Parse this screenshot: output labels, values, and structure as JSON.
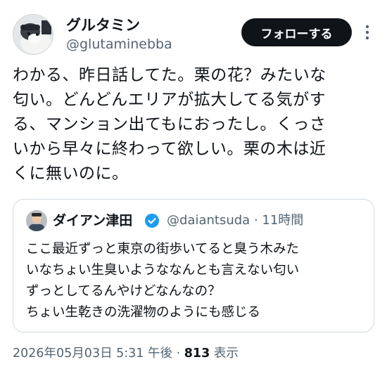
{
  "author": {
    "display_name": "グルタミン",
    "handle": "@glutaminebba"
  },
  "follow_label": "フォローする",
  "tweet": {
    "lines": [
      "わかる、昨日話してた。栗の花？みたいな",
      "匂い。どんどんエリアが拡大してる気がす",
      "る、マンション出てもにおったし。くっさ",
      "いから早々に終わって欲しい。栗の木は近",
      "くに無いのに。"
    ]
  },
  "quote": {
    "display_name": "ダイアン津田",
    "handle": "@daiantsuda",
    "separator": "·",
    "time": "11時間",
    "lines": [
      "ここ最近ずっと東京の街歩いてると臭う木みた",
      "いなちょい生臭いようななんとも言えない匂い",
      "ずっとしてるんやけどなんなの？",
      "ちょい生乾きの洗濯物のようにも感じる"
    ]
  },
  "meta": {
    "timestamp": "2026年05月03日 5:31 午後",
    "separator": "·",
    "views_count": "813",
    "views_label": "表示"
  },
  "colors": {
    "text": "#0f1419",
    "secondary": "#536471",
    "verified": "#1d9bf0",
    "border": "#cfd9de"
  }
}
